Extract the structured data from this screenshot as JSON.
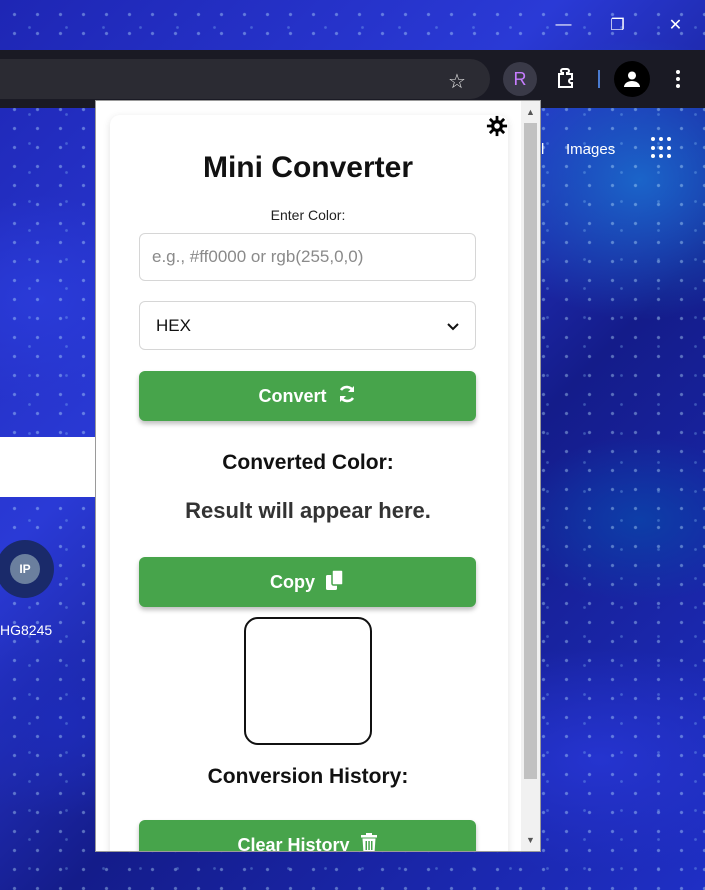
{
  "window": {
    "minimize_glyph": "—",
    "restore_glyph": "❐",
    "close_glyph": "✕"
  },
  "toolbar": {
    "extension_letter": "R"
  },
  "background_page": {
    "gmail_fragment": "l",
    "images_link": "Images",
    "shortcut_initials": "IP",
    "shortcut_label": "HG8245"
  },
  "popup": {
    "title": "Mini Converter",
    "input_label": "Enter Color:",
    "input_placeholder": "e.g., #ff0000 or rgb(255,0,0)",
    "input_value": "",
    "format_selected": "HEX",
    "convert_label": "Convert",
    "converted_heading": "Converted Color:",
    "result_text": "Result will appear here.",
    "copy_label": "Copy",
    "history_heading": "Conversion History:",
    "clear_label": "Clear History",
    "swatch_color": "#ffffff"
  },
  "colors": {
    "button_green": "#47a44b",
    "extension_letter_purple": "#c77dff"
  }
}
